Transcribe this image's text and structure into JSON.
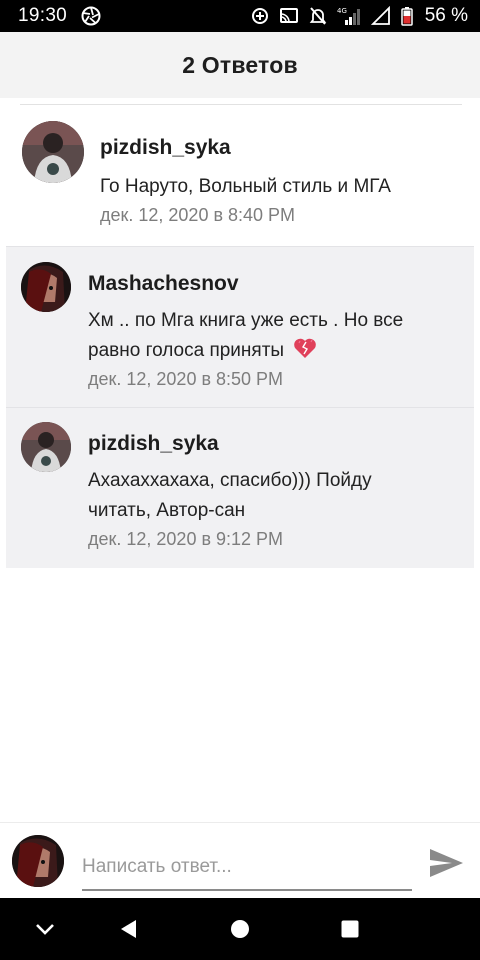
{
  "status_bar": {
    "time": "19:30",
    "battery": "56 %",
    "network": "4G",
    "icons": [
      "aperture-icon",
      "data-saver-icon",
      "cast-icon",
      "mute-icon",
      "signal-icon",
      "wifi-signal-icon",
      "battery-icon"
    ]
  },
  "header": {
    "title": "2 Ответов"
  },
  "comments": [
    {
      "username": "pizdish_syka",
      "text": "Го Наруто, Вольный стиль и МГА",
      "date": "дек. 12, 2020 в 8:40 PM"
    }
  ],
  "replies": [
    {
      "username": "Mashachesnov",
      "text": "Хм .. по Мга книга уже есть . Но все равно голоса приняты",
      "emoji": "heart-emoji",
      "date": "дек. 12, 2020 в 8:50 PM"
    },
    {
      "username": "pizdish_syka",
      "text": "Ахахаххахаха, спасибо))) Пойду читать, Автор-сан",
      "date": "дек. 12, 2020 в 9:12 PM"
    }
  ],
  "reply_bar": {
    "placeholder": "Написать ответ...",
    "value": ""
  },
  "nav": {
    "icons": [
      "chevron-down-icon",
      "back-icon",
      "home-icon",
      "recents-icon"
    ]
  },
  "colors": {
    "header_bg": "#f3f3f3",
    "nested_bg": "#f1f1f3",
    "date_gray": "#7d7d7d",
    "send_gray": "#8a8a8a"
  }
}
